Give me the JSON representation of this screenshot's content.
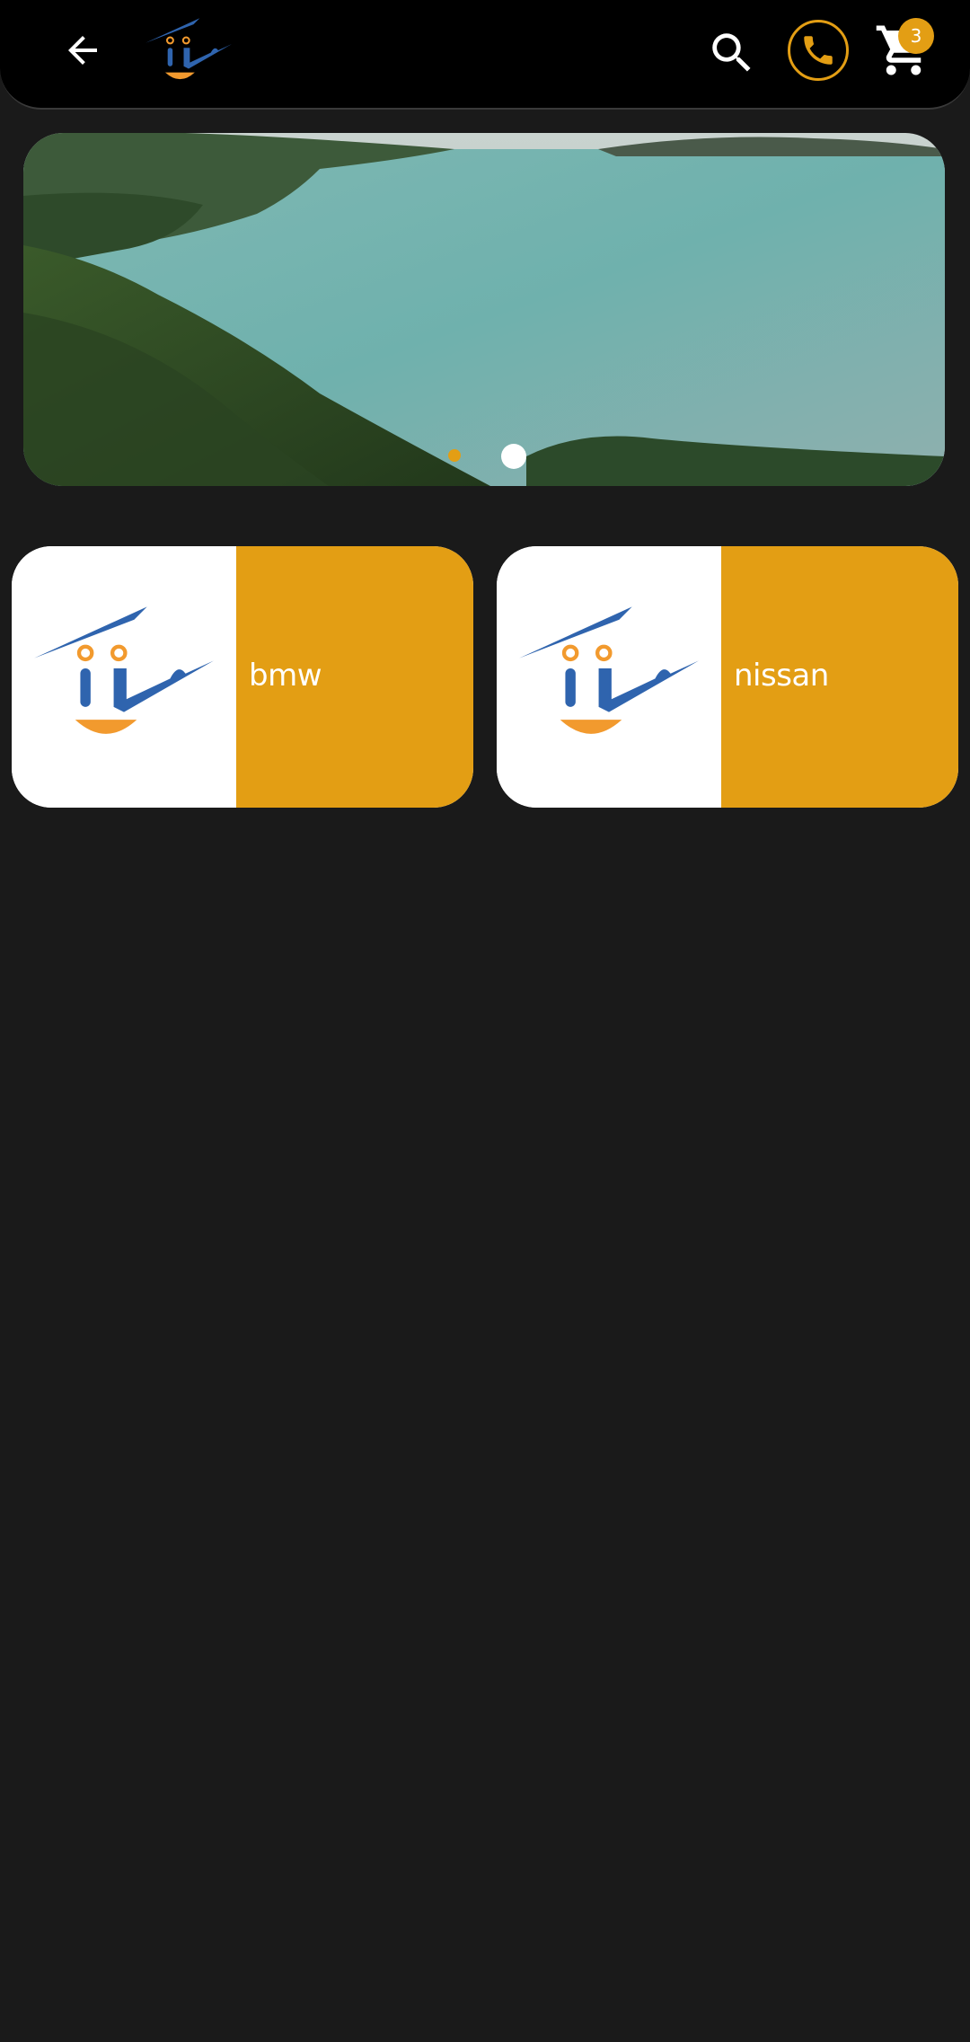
{
  "appbar": {
    "back_icon": "arrow-left-icon",
    "logo_icon": "brand-logo-icon",
    "search_icon": "search-icon",
    "phone_icon": "phone-icon",
    "cart_icon": "cart-icon",
    "cart_count": "3"
  },
  "banner": {
    "image": "landscape-lake-forest",
    "active_dot": 1,
    "total_dots": 2
  },
  "brands": [
    {
      "label": "bmw",
      "icon": "brand-logo-icon"
    },
    {
      "label": "nissan",
      "icon": "brand-logo-icon"
    }
  ],
  "colors": {
    "accent": "#e39e14",
    "background": "#1a1a1a",
    "appbar": "#000000",
    "logo_blue": "#2f64ae",
    "logo_orange": "#f29a2e"
  }
}
